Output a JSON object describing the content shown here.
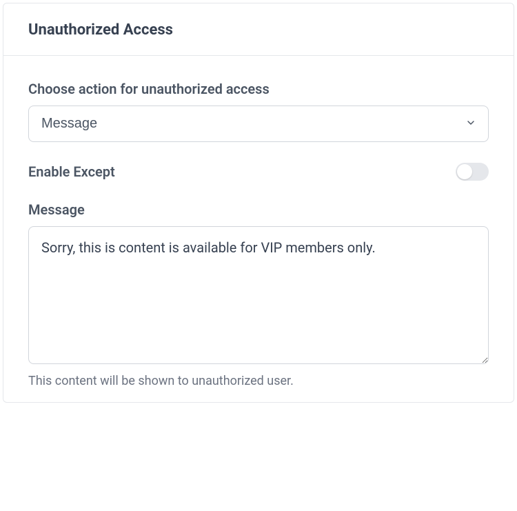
{
  "panel": {
    "title": "Unauthorized Access"
  },
  "action": {
    "label": "Choose action for unauthorized access",
    "selected": "Message"
  },
  "enableExcept": {
    "label": "Enable Except",
    "value": false
  },
  "message": {
    "label": "Message",
    "value": "Sorry, this is content is available for VIP members only.",
    "helper": "This content will be shown to unauthorized user."
  }
}
